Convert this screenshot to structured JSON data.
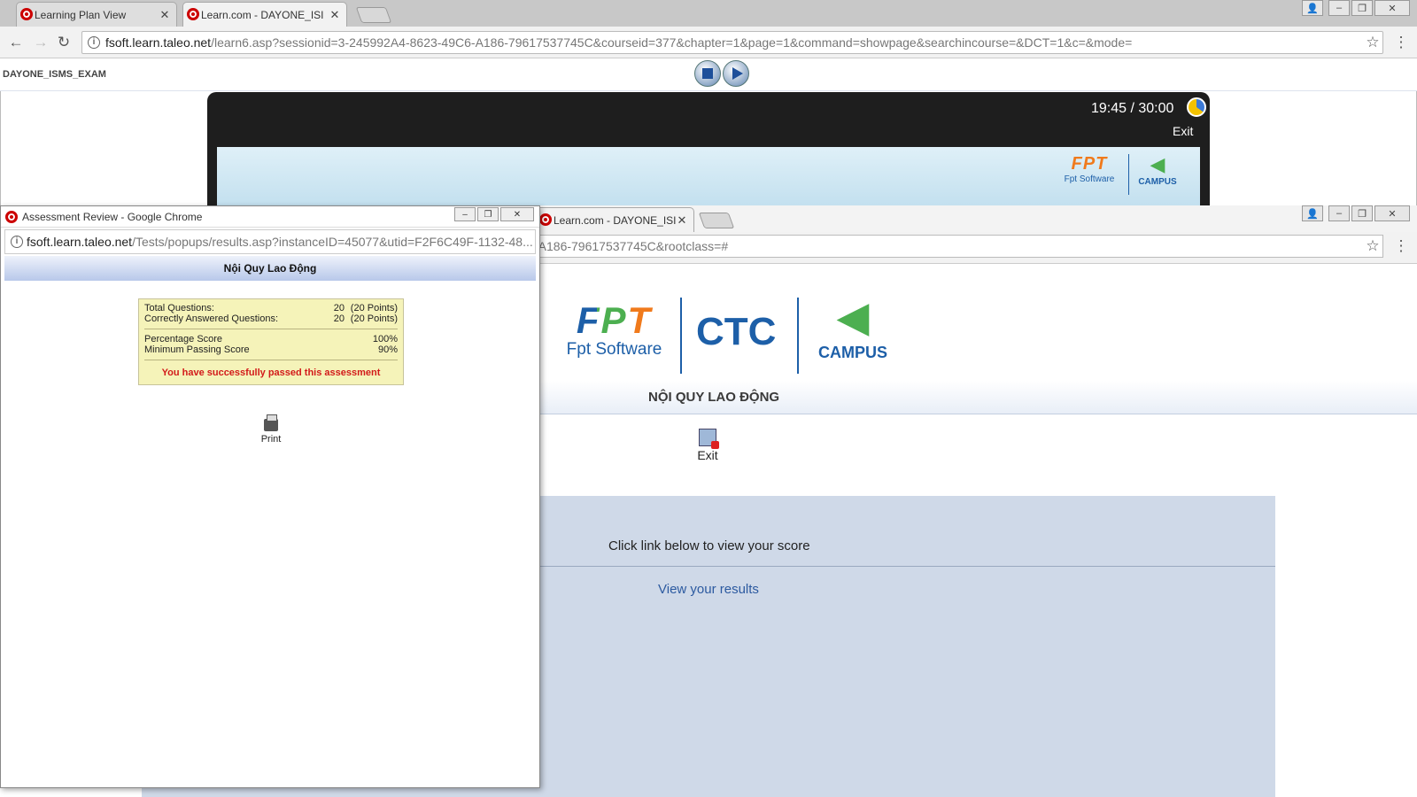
{
  "browser": {
    "tabs": [
      {
        "label": "Learning Plan View",
        "active": false
      },
      {
        "label": "Learn.com - DAYONE_ISI",
        "active": true
      }
    ],
    "url_host": "fsoft.learn.taleo.net",
    "url_path": "/learn6.asp?sessionid=3-245992A4-8623-49C6-A186-79617537745C&courseid=377&chapter=1&page=1&command=showpage&searchincourse=&DCT=1&c=&mode="
  },
  "course_bar": {
    "title": "DAYONE_ISMS_EXAM"
  },
  "player": {
    "timer": "19:45 / 30:00",
    "exit_label": "Exit",
    "banner_brand_1": "Fpt Software",
    "banner_brand_2": "CAMPUS"
  },
  "second_window": {
    "tab_label": "Learn.com - DAYONE_ISI",
    "url_tail": "-A186-79617537745C&rootclass=#",
    "logo_fpt": "FPT",
    "logo_fpt_sub": "Fpt Software",
    "logo_ctc": "CTC",
    "logo_campus": "CAMPUS",
    "course_title": "NỘI QUY LAO ĐỘNG",
    "exit_label": "Exit",
    "click_message": "Click link below to view your score",
    "view_results_link": "View your results"
  },
  "popup": {
    "window_title": "Assessment Review - Google Chrome",
    "url_host": "fsoft.learn.taleo.net",
    "url_path": "/Tests/popups/results.asp?instanceID=45077&utid=F2F6C49F-1132-48...",
    "header": "Nội Quy Lao Động",
    "total_questions_label": "Total Questions:",
    "total_questions_value": "20",
    "total_questions_points": "(20 Points)",
    "correct_label": "Correctly Answered Questions:",
    "correct_value": "20",
    "correct_points": "(20 Points)",
    "percentage_label": "Percentage Score",
    "percentage_value": "100%",
    "min_passing_label": "Minimum Passing Score",
    "min_passing_value": "90%",
    "pass_message": "You have successfully passed this assessment",
    "print_label": "Print"
  },
  "colors": {
    "accent": "#2c5aa0",
    "pass": "#d21a1a",
    "score_bg": "#f5f3b9",
    "panel": "#cfd9e8"
  }
}
